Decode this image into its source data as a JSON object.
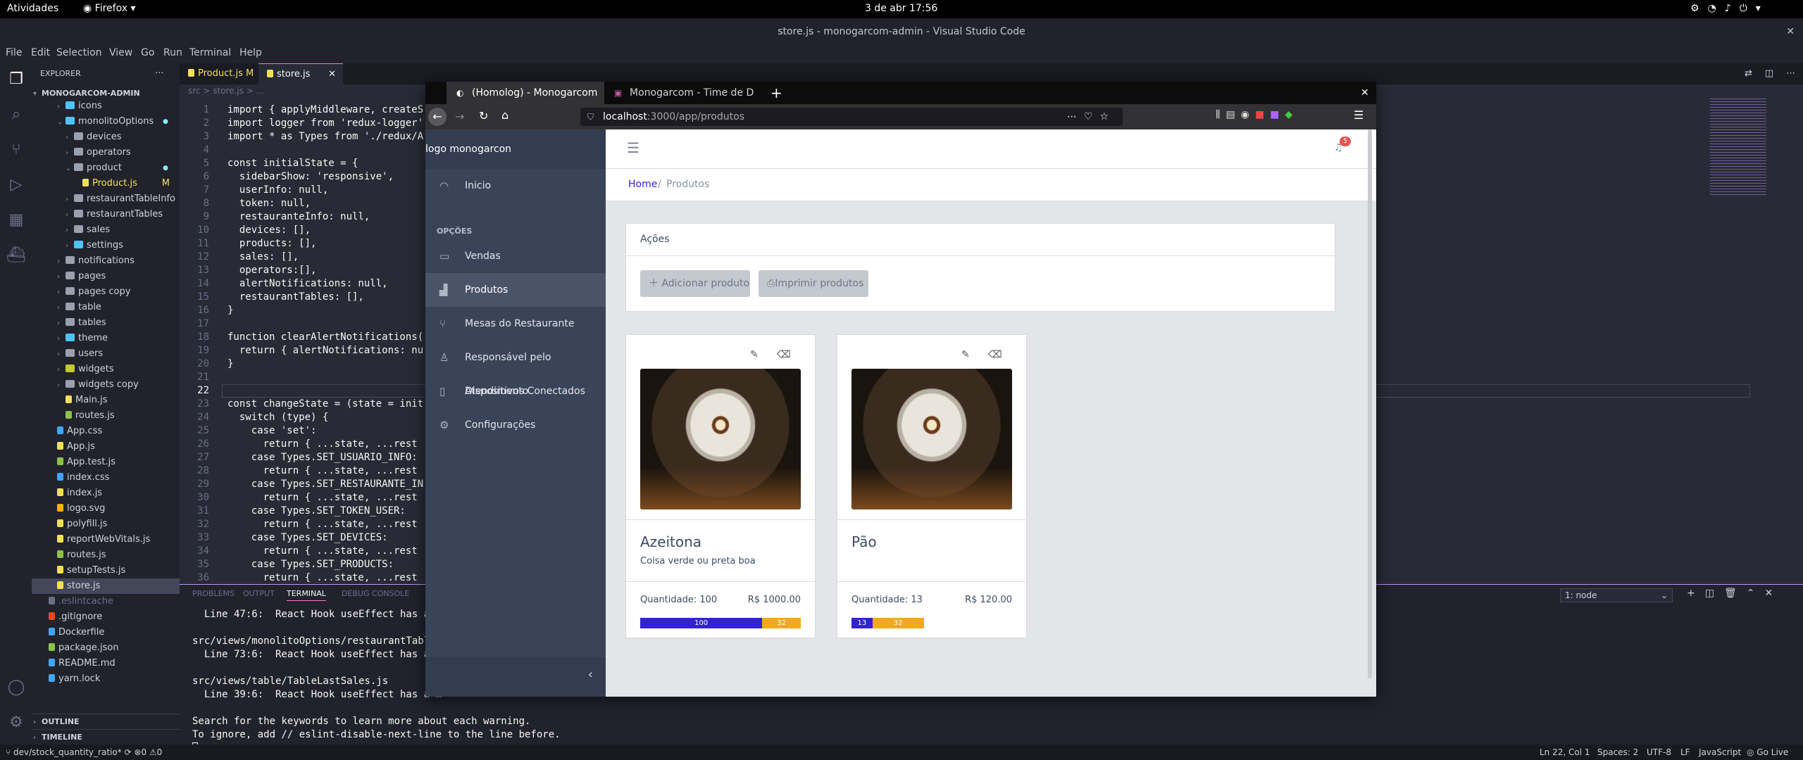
{
  "topbar": {
    "activities": "Atividades",
    "app": "Firefox",
    "clock": "3 de abr  17:56"
  },
  "vscode": {
    "title": "store.js - monogarcom-admin - Visual Studio Code",
    "menu": [
      "File",
      "Edit",
      "Selection",
      "View",
      "Go",
      "Run",
      "Terminal",
      "Help"
    ],
    "explorer_title": "EXPLORER",
    "workspace": "MONOGARCOM-ADMIN",
    "tree": [
      {
        "label": "icons",
        "type": "folder",
        "indent": 1,
        "color": "#4fc3f7"
      },
      {
        "label": "monolitoOptions",
        "type": "folder-open",
        "indent": 1,
        "color": "#4fc3f7",
        "mod": true
      },
      {
        "label": "devices",
        "type": "folder",
        "indent": 2,
        "color": "#9aa0ad"
      },
      {
        "label": "operators",
        "type": "folder",
        "indent": 2,
        "color": "#9aa0ad"
      },
      {
        "label": "product",
        "type": "folder-open",
        "indent": 2,
        "color": "#9aa0ad",
        "mod": true
      },
      {
        "label": "Product.js",
        "type": "file",
        "indent": 3,
        "color": "#f1e05a",
        "badge": "M"
      },
      {
        "label": "restaurantTableInfo",
        "type": "folder",
        "indent": 2,
        "color": "#9aa0ad"
      },
      {
        "label": "restaurantTables",
        "type": "folder",
        "indent": 2,
        "color": "#9aa0ad"
      },
      {
        "label": "sales",
        "type": "folder",
        "indent": 2,
        "color": "#9aa0ad"
      },
      {
        "label": "settings",
        "type": "folder",
        "indent": 2,
        "color": "#4fc3f7"
      },
      {
        "label": "notifications",
        "type": "folder",
        "indent": 1,
        "color": "#9aa0ad"
      },
      {
        "label": "pages",
        "type": "folder",
        "indent": 1,
        "color": "#9aa0ad"
      },
      {
        "label": "pages copy",
        "type": "folder",
        "indent": 1,
        "color": "#9aa0ad"
      },
      {
        "label": "table",
        "type": "folder",
        "indent": 1,
        "color": "#9aa0ad"
      },
      {
        "label": "tables",
        "type": "folder",
        "indent": 1,
        "color": "#9aa0ad"
      },
      {
        "label": "theme",
        "type": "folder",
        "indent": 1,
        "color": "#4fc3f7"
      },
      {
        "label": "users",
        "type": "folder",
        "indent": 1,
        "color": "#9aa0ad"
      },
      {
        "label": "widgets",
        "type": "folder",
        "indent": 1,
        "color": "#c0ca33"
      },
      {
        "label": "widgets copy",
        "type": "folder",
        "indent": 1,
        "color": "#9aa0ad"
      },
      {
        "label": "Main.js",
        "type": "file",
        "indent": 1,
        "color": "#f1e05a"
      },
      {
        "label": "routes.js",
        "type": "file",
        "indent": 1,
        "color": "#8bc34a"
      },
      {
        "label": "App.css",
        "type": "file",
        "indent": 0,
        "color": "#42a5f5"
      },
      {
        "label": "App.js",
        "type": "file",
        "indent": 0,
        "color": "#f1e05a"
      },
      {
        "label": "App.test.js",
        "type": "file",
        "indent": 0,
        "color": "#8bc34a"
      },
      {
        "label": "index.css",
        "type": "file",
        "indent": 0,
        "color": "#42a5f5"
      },
      {
        "label": "index.js",
        "type": "file",
        "indent": 0,
        "color": "#f1e05a"
      },
      {
        "label": "logo.svg",
        "type": "file",
        "indent": 0,
        "color": "#ffb300"
      },
      {
        "label": "polyfill.js",
        "type": "file",
        "indent": 0,
        "color": "#f1e05a"
      },
      {
        "label": "reportWebVitals.js",
        "type": "file",
        "indent": 0,
        "color": "#f1e05a"
      },
      {
        "label": "routes.js",
        "type": "file",
        "indent": 0,
        "color": "#8bc34a"
      },
      {
        "label": "setupTests.js",
        "type": "file",
        "indent": 0,
        "color": "#f1e05a"
      },
      {
        "label": "store.js",
        "type": "file",
        "indent": 0,
        "color": "#f1e05a",
        "active": true
      },
      {
        "label": ".eslintcache",
        "type": "file",
        "indent": -1,
        "color": "#6c7086",
        "dim": true
      },
      {
        "label": ".gitignore",
        "type": "file",
        "indent": -1,
        "color": "#e64a19"
      },
      {
        "label": "Dockerfile",
        "type": "file",
        "indent": -1,
        "color": "#42a5f5"
      },
      {
        "label": "package.json",
        "type": "file",
        "indent": -1,
        "color": "#8bc34a"
      },
      {
        "label": "README.md",
        "type": "file",
        "indent": -1,
        "color": "#42a5f5"
      },
      {
        "label": "yarn.lock",
        "type": "file",
        "indent": -1,
        "color": "#42a5f5"
      }
    ],
    "outline": "OUTLINE",
    "timeline": "TIMELINE",
    "tabs": [
      {
        "label": "Product.js M"
      },
      {
        "label": "store.js"
      }
    ],
    "breadcrumb": "src  >  store.js  >  ...",
    "code": [
      "import { applyMiddleware, createS",
      "import logger from 'redux-logger'",
      "import * as Types from './redux/A",
      "",
      "const initialState = {",
      "  sidebarShow: 'responsive',",
      "  userInfo: null,",
      "  token: null,",
      "  restauranteInfo: null,",
      "  devices: [],",
      "  products: [],",
      "  sales: [],",
      "  operators:[],",
      "  alertNotifications: null,",
      "  restaurantTables: [],",
      "}",
      "",
      "function clearAlertNotifications(",
      "  return { alertNotifications: nu",
      "}",
      "",
      "",
      "const changeState = (state = init",
      "  switch (type) {",
      "    case 'set':",
      "      return { ...state, ...rest",
      "    case Types.SET_USUARIO_INFO:",
      "      return { ...state, ...rest",
      "    case Types.SET_RESTAURANTE_IN",
      "      return { ...state, ...rest",
      "    case Types.SET_TOKEN_USER:",
      "      return { ...state, ...rest",
      "    case Types.SET_DEVICES:",
      "      return { ...state, ...rest",
      "    case Types.SET_PRODUCTS:",
      "      return { ...state, ...rest"
    ],
    "panel_tabs": [
      "PROBLEMS",
      "OUTPUT",
      "TERMINAL",
      "DEBUG CONSOLE"
    ],
    "terminal_select": "1: node",
    "terminal": [
      "  Line 47:6:  React Hook useEffect has a m",
      "",
      "src/views/monolitoOptions/restaurantTable",
      "  Line 73:6:  React Hook useEffect has a m",
      "",
      "src/views/table/TableLastSales.js",
      "  Line 39:6:  React Hook useEffect has a m",
      "",
      "Search for the keywords to learn more about each warning.",
      "To ignore, add // eslint-disable-next-line to the line before.",
      ""
    ],
    "status": {
      "branch": "dev/stock_quantity_ratio*",
      "errors": "0",
      "warnings": "0",
      "position": "Ln 22, Col 1",
      "spaces": "Spaces: 2",
      "encoding": "UTF-8",
      "eol": "LF",
      "language": "JavaScript",
      "golive": "Go Live"
    }
  },
  "firefox": {
    "tabs": [
      {
        "label": "(Homolog) - Monogarcom"
      },
      {
        "label": "Monogarcom - Time de D"
      }
    ],
    "url_host": "localhost",
    "url_path": ":3000/app/produtos"
  },
  "app": {
    "logo_alt": "logo monogarcon",
    "nav_home": "Inicio",
    "section": "OPÇÕES",
    "nav": [
      {
        "label": "Vendas",
        "icon": "card-icon"
      },
      {
        "label": "Produtos",
        "icon": "product-icon",
        "active": true
      },
      {
        "label": "Mesas do Restaurante",
        "icon": "cutlery-icon"
      },
      {
        "label": "Responsável pelo Atendimento",
        "icon": "user-icon"
      },
      {
        "label": "Dispositivos Conectados",
        "icon": "phone-icon"
      },
      {
        "label": "Configurações",
        "icon": "gear-icon"
      }
    ],
    "notification_count": "5",
    "breadcrumb": {
      "home": "Home",
      "current": "Produtos"
    },
    "actions_title": "Ações",
    "btn_add": "Adicionar produto",
    "btn_print": "Imprimir produtos",
    "products": [
      {
        "name": "Azeitona",
        "description": "Coisa verde ou preta boa",
        "quantity_label": "Quantidade: 100",
        "price": "R$ 1000.00",
        "bar_blue": "100",
        "bar_orange": "32",
        "blue_fraction": 0.76,
        "bar_fraction": 1.0
      },
      {
        "name": "Pão",
        "description": "",
        "quantity_label": "Quantidade: 13",
        "price": "R$ 120.00",
        "bar_blue": "13",
        "bar_orange": "32",
        "blue_fraction": 0.29,
        "bar_fraction": 0.45
      }
    ]
  }
}
